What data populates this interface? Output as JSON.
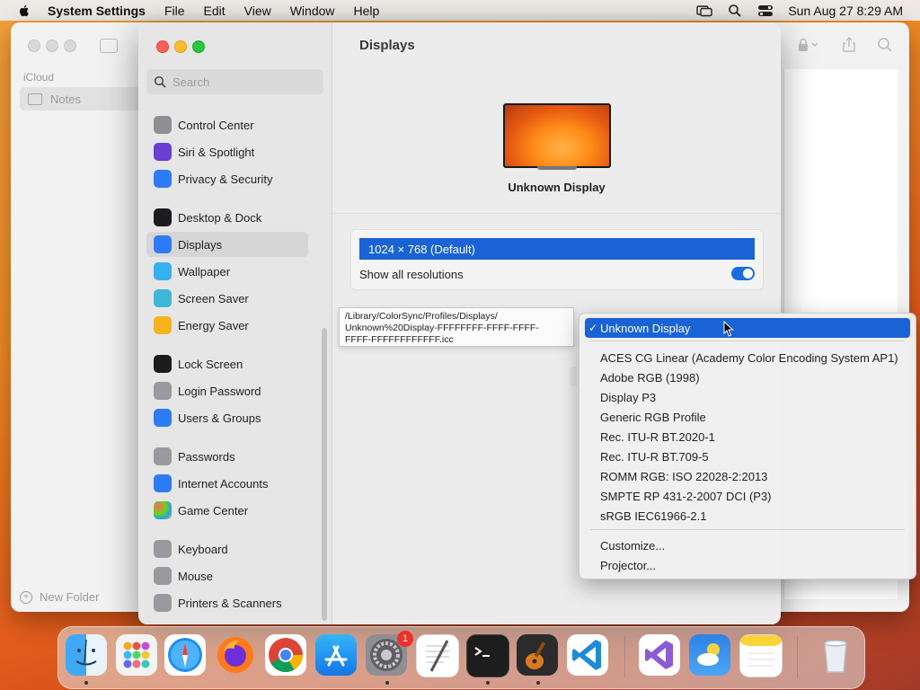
{
  "menubar": {
    "app_name": "System Settings",
    "menus": [
      "File",
      "Edit",
      "View",
      "Window",
      "Help"
    ],
    "clock": "Sun Aug 27  8:29 AM"
  },
  "notes": {
    "section": "iCloud",
    "folder": "Notes",
    "new_folder": "New Folder"
  },
  "settings": {
    "search_placeholder": "Search",
    "sidebar": [
      {
        "label": "Control Center",
        "icon": "control-center-icon",
        "color": "#8e8e93"
      },
      {
        "label": "Siri & Spotlight",
        "icon": "siri-icon",
        "color": "#6b3fd1"
      },
      {
        "label": "Privacy & Security",
        "icon": "hand-icon",
        "color": "#2d7cf6"
      },
      {
        "label": "Desktop & Dock",
        "icon": "dock-icon",
        "color": "#1c1c1e"
      },
      {
        "label": "Displays",
        "icon": "sun-icon",
        "color": "#2d7cf6"
      },
      {
        "label": "Wallpaper",
        "icon": "flower-icon",
        "color": "#38b0f0"
      },
      {
        "label": "Screen Saver",
        "icon": "screen-saver-icon",
        "color": "#3fb6d8"
      },
      {
        "label": "Energy Saver",
        "icon": "lightbulb-icon",
        "color": "#f5b31c"
      },
      {
        "label": "Lock Screen",
        "icon": "lock-icon",
        "color": "#1c1c1e"
      },
      {
        "label": "Login Password",
        "icon": "padlock-icon",
        "color": "#9a9a9e"
      },
      {
        "label": "Users & Groups",
        "icon": "users-icon",
        "color": "#2d7cf6"
      },
      {
        "label": "Passwords",
        "icon": "key-icon",
        "color": "#9a9a9e"
      },
      {
        "label": "Internet Accounts",
        "icon": "at-icon",
        "color": "#2d7cf6"
      },
      {
        "label": "Game Center",
        "icon": "game-center-icon",
        "color": "#ffffff"
      },
      {
        "label": "Keyboard",
        "icon": "keyboard-icon",
        "color": "#9a9a9e"
      },
      {
        "label": "Mouse",
        "icon": "mouse-icon",
        "color": "#9a9a9e"
      },
      {
        "label": "Printers & Scanners",
        "icon": "printer-icon",
        "color": "#9a9a9e"
      }
    ],
    "selected": "Displays",
    "pane_title": "Displays",
    "display_name": "Unknown Display",
    "resolution": "1024 × 768 (Default)",
    "show_all_label": "Show all resolutions",
    "show_all_on": true,
    "tooltip": "/Library/ColorSync/Profiles/Displays/\nUnknown%20Display-FFFFFFFF-FFFF-FFFF-\nFFFF-FFFFFFFFFFFF.icc",
    "color_profiles": [
      "Unknown Display",
      "ACES CG Linear (Academy Color Encoding System AP1)",
      "Adobe RGB (1998)",
      "Display P3",
      "Generic RGB Profile",
      "Rec. ITU-R BT.2020-1",
      "Rec. ITU-R BT.709-5",
      "ROMM RGB: ISO 22028-2:2013",
      "SMPTE RP 431-2-2007 DCI (P3)",
      "sRGB IEC61966-2.1",
      "Customize...",
      "Projector..."
    ],
    "color_profile_selected": "Unknown Display"
  },
  "dock": {
    "badge_system_settings": "1",
    "apps": [
      "finder-icon",
      "launchpad-icon",
      "safari-icon",
      "firefox-icon",
      "chrome-icon",
      "app-store-icon",
      "system-settings-icon",
      "textedit-icon",
      "terminal-icon",
      "garageband-icon",
      "vscode-icon",
      "visual-studio-icon",
      "weather-icon",
      "notes-icon",
      "trash-icon"
    ]
  }
}
